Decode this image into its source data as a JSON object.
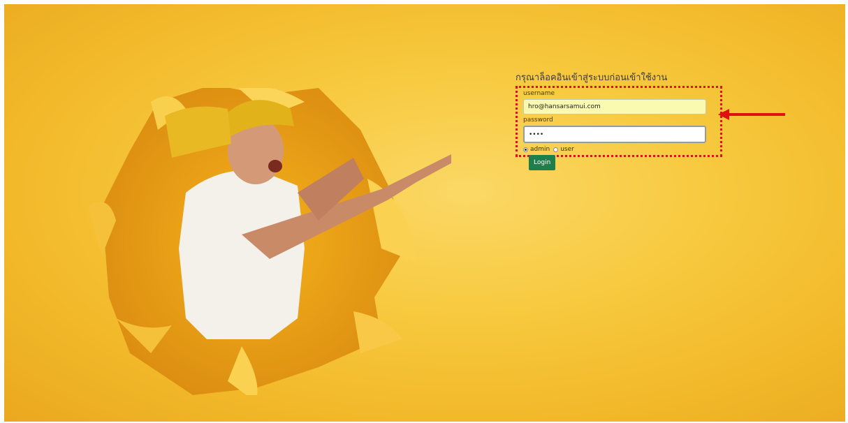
{
  "login": {
    "title": "กรุณาล็อคอินเข้าสู่ระบบก่อนเข้าใช้งาน",
    "username_label": "username",
    "username_value": "hro@hansarsamui.com",
    "password_label": "password",
    "password_value": "••••",
    "roles": [
      {
        "label": "admin",
        "selected": true
      },
      {
        "label": "user",
        "selected": false
      }
    ],
    "submit_label": "Login"
  },
  "colors": {
    "background_accent": "#f7c93e",
    "highlight_border": "#e11010",
    "button": "#1e7f4c"
  },
  "icons": [
    "red-arrow-annotation-icon",
    "man-pointing-illustration"
  ]
}
